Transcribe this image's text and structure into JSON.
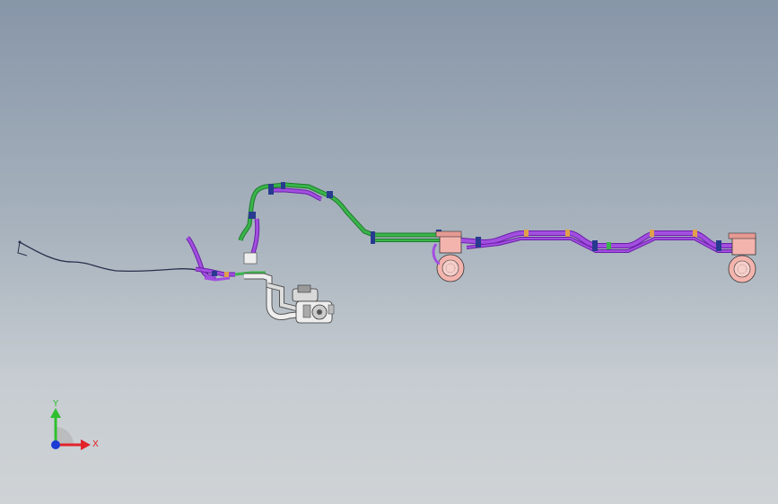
{
  "viewport": {
    "background_top": "#8796a8",
    "background_bottom": "#cfd3d6"
  },
  "triad": {
    "x_label": "X",
    "y_label": "Y",
    "x_color": "#e0242a",
    "y_color": "#2fbf2f",
    "z_color": "#1b3bd6"
  },
  "colors": {
    "pipe_green": "#39b54a",
    "pipe_purple": "#a24fe0",
    "pipe_purple_dark": "#6a1ea8",
    "clamp_blue": "#283a8f",
    "fitting_orange": "#e0a04a",
    "blower_pink": "#f4b4ae",
    "cable": "#2a2f4d",
    "pump_gray": "#d8d8d8"
  }
}
